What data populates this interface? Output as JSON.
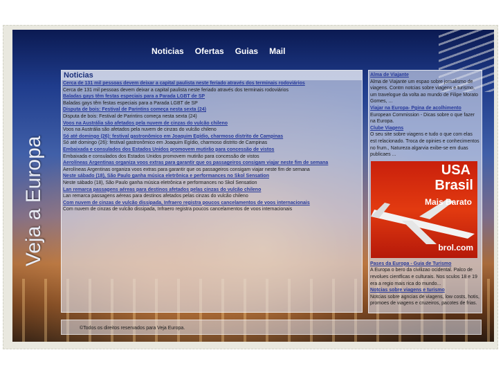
{
  "brand": {
    "vertical_title": "Veja a Europa"
  },
  "nav": {
    "items": [
      "Noticias",
      "Ofertas",
      "Guias",
      "Mail"
    ]
  },
  "news": {
    "heading": "Noticias",
    "items": [
      {
        "title": "Cerca de 131 mil pessoas devem deixar a capital paulista neste feriado através dos terminais rodoviários",
        "desc": "Cerca de 131 mil pessoas devem deixar a capital paulista neste feriado através dos terminais rodoviários"
      },
      {
        "title": "Baladas gays têm festas especiais para a Parada LGBT de SP",
        "desc": "Baladas gays têm festas especiais para a Parada LGBT de SP"
      },
      {
        "title": "Disputa de bois: Festival de Parintins começa nesta sexta (24)",
        "desc": "Disputa de bois: Festival de Parintins começa nesta sexta (24)"
      },
      {
        "title": "Voos na Austrália são afetados pela nuvem de cinzas do vulcão chileno",
        "desc": "Voos na Austrália são afetados pela nuvem de cinzas do vulcão chileno"
      },
      {
        "title": "Só até domingo (26): festival gastronômico em Joaquim Egídio, charmoso distrito de Campinas",
        "desc": "Só até domingo (26): festival gastronômico em Joaquim Egídio, charmoso distrito de Campinas"
      },
      {
        "title": "Embaixada e consulados dos Estados Unidos promovem mutirão para concessão de vistos",
        "desc": "Embaixada e consulados dos Estados Unidos promovem mutirão para concessão de vistos"
      },
      {
        "title": "Aerolíneas Argentinas organiza voos extras para garantir que os passageiros consigam viajar neste fim de semana",
        "desc": "Aerolíneas Argentinas organiza voos extras para garantir que os passageiros consigam viajar neste fim de semana"
      },
      {
        "title": "Neste sábado (18), São Paulo ganha música eletrônica e performances no Skol Sensation",
        "desc": "Neste sábado (18), São Paulo ganha música eletrônica e performances no Skol Sensation"
      },
      {
        "title": "Lan remarca passagens aéreas para destinos afetados pelas cinzas do vulcão chileno",
        "desc": "Lan remarca passagens aéreas para destinos afetados pelas cinzas do vulcão chileno"
      },
      {
        "title": "Com nuvem de cinzas de vulcão dissipada, Infraero registra poucos cancelamentos de voos internacionais",
        "desc": "Com nuvem de cinzas de vulcão dissipada, Infraero registra poucos cancelamentos de voos internacionais"
      }
    ]
  },
  "sidebar": {
    "top": [
      {
        "title": "Alma de Viajante",
        "desc": "Alma de Viajante um espao sobre jornalismo de viagens. Contm notcias sobre viagens e turismo, um travelogue da volta ao mundo de Filipe Morato Gomes, ..."
      },
      {
        "title": "Viajar na Europa- Pgina de acolhimento",
        "desc": "European Commission - Dicas sobre o que fazer na Europa."
      },
      {
        "title": "Clube Viagens",
        "desc": "O seu site sobre viagens e tudo o que com elas est relacionado. Troca de opinies e conhecimentos no frum., Natureza algarvia exibe-se em duas publicaes ..."
      }
    ],
    "ad": {
      "line1": "USA",
      "line2": "Brasil",
      "line3": "Mais Barato",
      "line4": "brol.com"
    },
    "bottom": [
      {
        "title": "Pases da Europa - Guia de Turismo",
        "desc": "A Europa o bero da civilizao ocidental. Palco de revolues cientficas e culturais. Nos sculos 18 e 19 era a regio mais rica do mundo..."
      },
      {
        "title": "Notcias sobre viagens e turismo",
        "desc": "Notcias sobre agncias de viagens, low costs, hotis, promoes de viagens e cruzeiros, pacotes de frias."
      }
    ]
  },
  "footer": {
    "text": "©Todos os direitos reservados para Veja Europa."
  },
  "colors": {
    "link": "#25389a",
    "nav_text": "#ffffff",
    "ad_red": "#d42a0e"
  }
}
